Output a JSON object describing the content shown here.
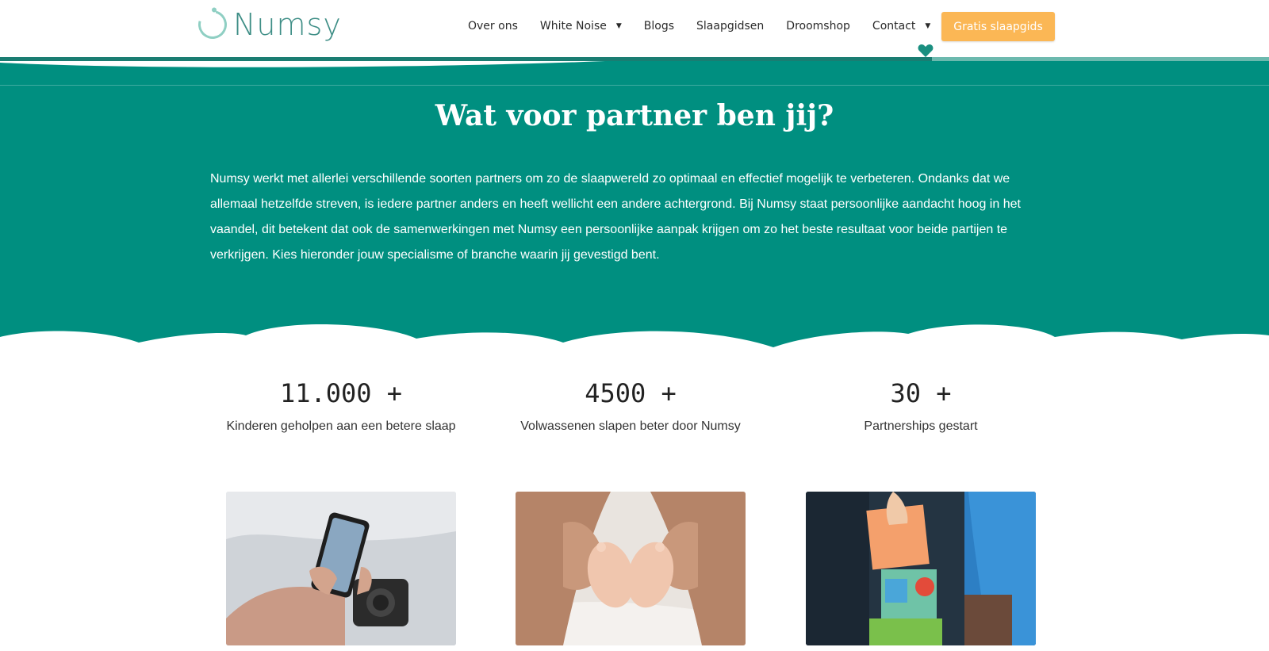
{
  "header": {
    "logo_text": "Numsy",
    "nav": [
      {
        "label": "Over ons",
        "has_dropdown": false
      },
      {
        "label": "White Noise",
        "has_dropdown": true
      },
      {
        "label": "Blogs",
        "has_dropdown": false
      },
      {
        "label": "Slaapgidsen",
        "has_dropdown": false
      },
      {
        "label": "Droomshop",
        "has_dropdown": false
      },
      {
        "label": "Contact",
        "has_dropdown": true
      }
    ],
    "cta_label": "Gratis slaapgids",
    "heart_icon": "heart-icon",
    "colors": {
      "cta": "#fbb755",
      "brand": "#008f80",
      "logo": "#3e8e86"
    }
  },
  "hero": {
    "title": "Wat voor partner ben jij?",
    "text": "Numsy werkt met allerlei verschillende soorten partners om zo de slaapwereld zo optimaal en effectief mogelijk te verbeteren. Ondanks dat we allemaal hetzelfde streven, is iedere partner anders en heeft wellicht een andere achtergrond. Bij Numsy staat persoonlijke aandacht hoog in het vaandel, dit betekent dat ook de samenwerkingen met Numsy een persoonlijke aanpak krijgen om zo het beste resultaat voor beide partijen te verkrijgen. Kies hieronder jouw specialisme of branche waarin jij gevestigd bent."
  },
  "stats": [
    {
      "number": "11.000 +",
      "label": "Kinderen geholpen aan een betere slaap"
    },
    {
      "number": "4500 +",
      "label": "Volwassenen slapen beter door Numsy"
    },
    {
      "number": "30 +",
      "label": "Partnerships gestart"
    }
  ],
  "cards": [
    {
      "image": "phone-in-hands-photo"
    },
    {
      "image": "baby-feet-in-hands-photo"
    },
    {
      "image": "toy-blocks-photo"
    }
  ]
}
